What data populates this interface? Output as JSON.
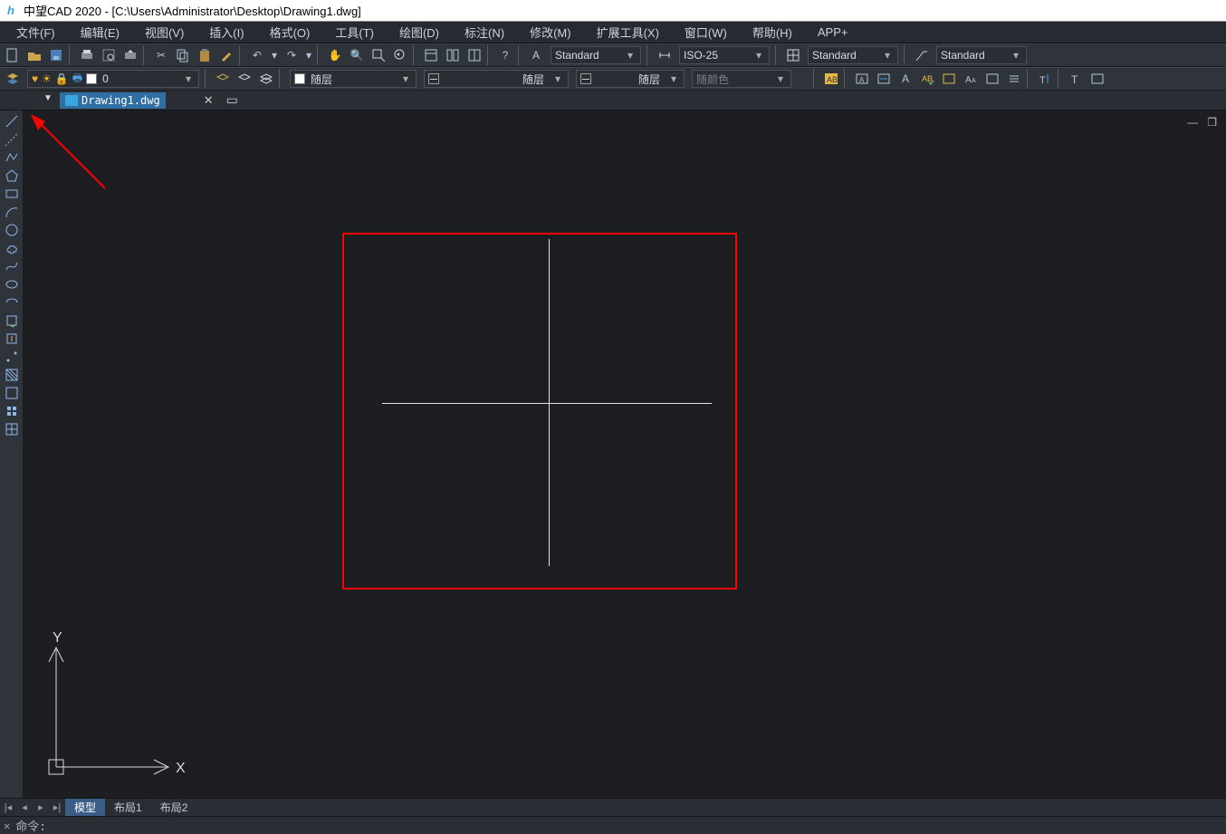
{
  "title": "中望CAD 2020 - [C:\\Users\\Administrator\\Desktop\\Drawing1.dwg]",
  "menu": [
    "文件(F)",
    "编辑(E)",
    "视图(V)",
    "插入(I)",
    "格式(O)",
    "工具(T)",
    "绘图(D)",
    "标注(N)",
    "修改(M)",
    "扩展工具(X)",
    "窗口(W)",
    "帮助(H)",
    "APP+"
  ],
  "style_combos": {
    "text_style": "Standard",
    "dim_style": "ISO-25",
    "table_style": "Standard",
    "mleader_style": "Standard"
  },
  "layer_row": {
    "layer": "0",
    "bylayer1": "随层",
    "bylayer2": "随层",
    "bylayer3": "随层",
    "bycolor": "随颜色"
  },
  "doc_tab": "Drawing1.dwg",
  "layout_tabs": {
    "model": "模型",
    "l1": "布局1",
    "l2": "布局2"
  },
  "ucs": {
    "x": "X",
    "y": "Y"
  },
  "cmd_prompt": "命令:",
  "icons": {
    "undo": "↶",
    "redo": "↷",
    "pan": "✋",
    "zoom": "🔍",
    "help": "?",
    "dd": "▾"
  }
}
